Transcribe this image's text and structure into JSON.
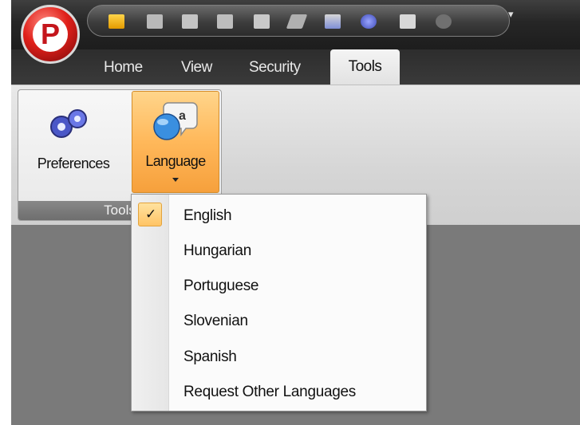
{
  "app": {
    "logo_letter": "P",
    "quick_access_icons": [
      "open-folder-icon",
      "save-icon",
      "print-icon",
      "edit-icon",
      "properties-icon",
      "sign-icon",
      "security-icon",
      "settings-icon",
      "document-icon"
    ]
  },
  "tabs": [
    {
      "label": "Home",
      "active": false
    },
    {
      "label": "View",
      "active": false
    },
    {
      "label": "Security",
      "active": false
    },
    {
      "label": "Tools",
      "active": true
    }
  ],
  "ribbon": {
    "group_caption": "Tools",
    "buttons": [
      {
        "label": "Preferences",
        "icon": "gears-icon"
      },
      {
        "label": "Language",
        "icon": "language-globe-icon",
        "highlighted": true,
        "has_dropdown": true
      }
    ]
  },
  "language_menu": {
    "items": [
      {
        "label": "English",
        "checked": true
      },
      {
        "label": "Hungarian",
        "checked": false
      },
      {
        "label": "Portuguese",
        "checked": false
      },
      {
        "label": "Slovenian",
        "checked": false
      },
      {
        "label": "Spanish",
        "checked": false
      },
      {
        "label": "Request Other Languages",
        "checked": false
      }
    ]
  },
  "colors": {
    "accent_orange": "#ffb85a",
    "logo_red": "#e0201a",
    "titlebar_dark": "#262626",
    "workspace_gray": "#7a7a7a"
  }
}
